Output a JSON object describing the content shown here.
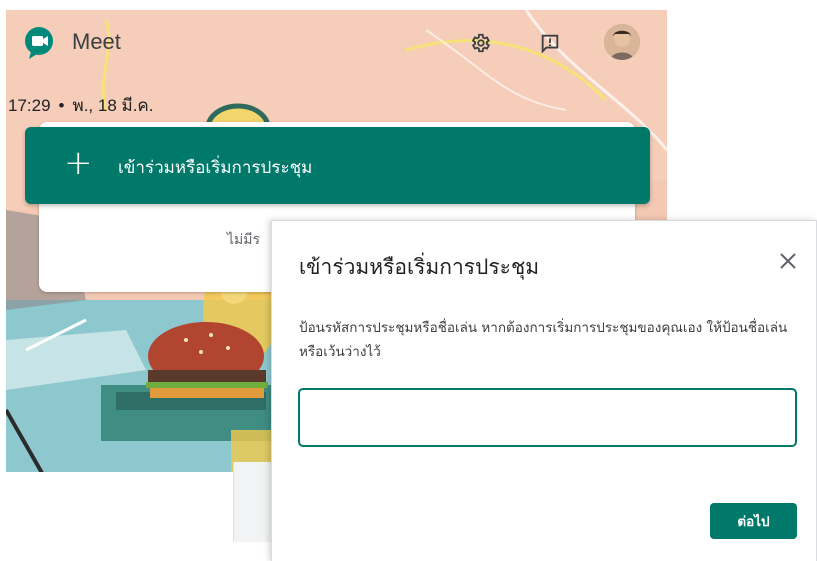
{
  "header": {
    "app_name": "Meet",
    "icons": [
      "settings-gear-icon",
      "feedback-icon",
      "avatar"
    ]
  },
  "datetime": {
    "time": "17:29",
    "separator": "•",
    "date": "พ., 18 มี.ค."
  },
  "main": {
    "join_button_icon": "+",
    "join_button_label": "เข้าร่วมหรือเริ่มการประชุม",
    "card_hint_partial": "ไม่มีร"
  },
  "dialog": {
    "title": "เข้าร่วมหรือเริ่มการประชุม",
    "close_icon": "×",
    "description": "ป้อนรหัสการประชุมหรือชื่อเล่น หากต้องการเริ่มการประชุมของคุณเอง ให้ป้อนชื่อเล่นหรือเว้นว่างไว้",
    "input_value": "",
    "input_placeholder": "",
    "next_label": "ต่อไป"
  },
  "colors": {
    "accent": "#00796b",
    "background_art": "#f3c9b4",
    "text_primary": "#202124"
  }
}
